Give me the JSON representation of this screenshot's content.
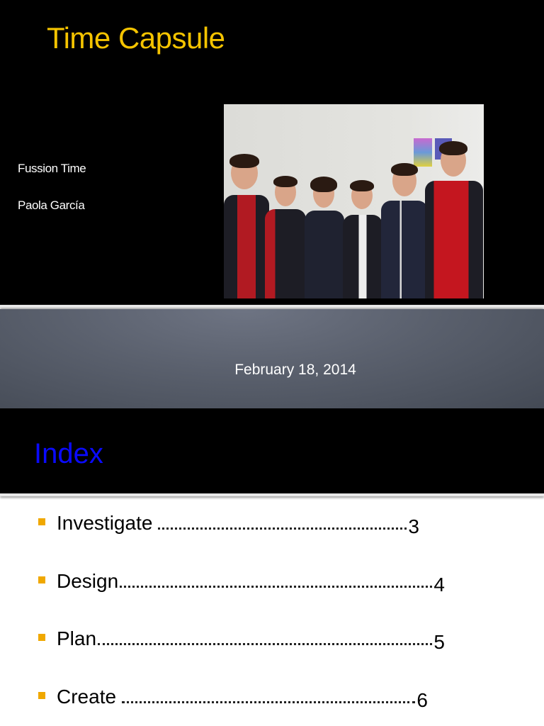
{
  "slide1": {
    "title": "Time Capsule",
    "team": "Fussion Time",
    "author": "Paola García",
    "photo": "group-photo-students"
  },
  "slide2": {
    "date": "February 18, 2014"
  },
  "slide3": {
    "heading": "Index",
    "items": [
      {
        "label": "Investigate",
        "page": "3"
      },
      {
        "label": "Design",
        "page": "4"
      },
      {
        "label": "Plan",
        "page": "5"
      },
      {
        "label": "Create",
        "page": "6"
      }
    ]
  },
  "colors": {
    "title": "#f5c400",
    "index_heading": "#0a0aff",
    "bullet": "#f0a800"
  }
}
